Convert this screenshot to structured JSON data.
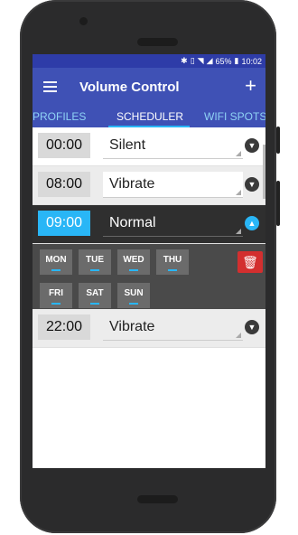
{
  "statusbar": {
    "battery_text": "65%",
    "time": "10:02"
  },
  "appbar": {
    "title": "Volume Control",
    "add_label": "+"
  },
  "tabs": [
    {
      "label": "PROFILES",
      "active": false
    },
    {
      "label": "SCHEDULER",
      "active": true
    },
    {
      "label": "WIFI SPOTS",
      "active": false
    }
  ],
  "schedule": [
    {
      "time": "00:00",
      "profile": "Silent",
      "expanded": false
    },
    {
      "time": "08:00",
      "profile": "Vibrate",
      "expanded": false
    },
    {
      "time": "09:00",
      "profile": "Normal",
      "expanded": true
    },
    {
      "time": "22:00",
      "profile": "Vibrate",
      "expanded": false
    }
  ],
  "days": [
    "MON",
    "TUE",
    "WED",
    "THU",
    "FRI",
    "SAT",
    "SUN"
  ],
  "colors": {
    "primary": "#3f51b5",
    "accent": "#29b6f6",
    "delete": "#d32f2f"
  },
  "icons": {
    "menu": "hamburger-menu-icon",
    "add": "plus-icon",
    "collapse": "chevron-down-icon",
    "expand": "chevron-up-icon",
    "delete": "trash-icon"
  }
}
